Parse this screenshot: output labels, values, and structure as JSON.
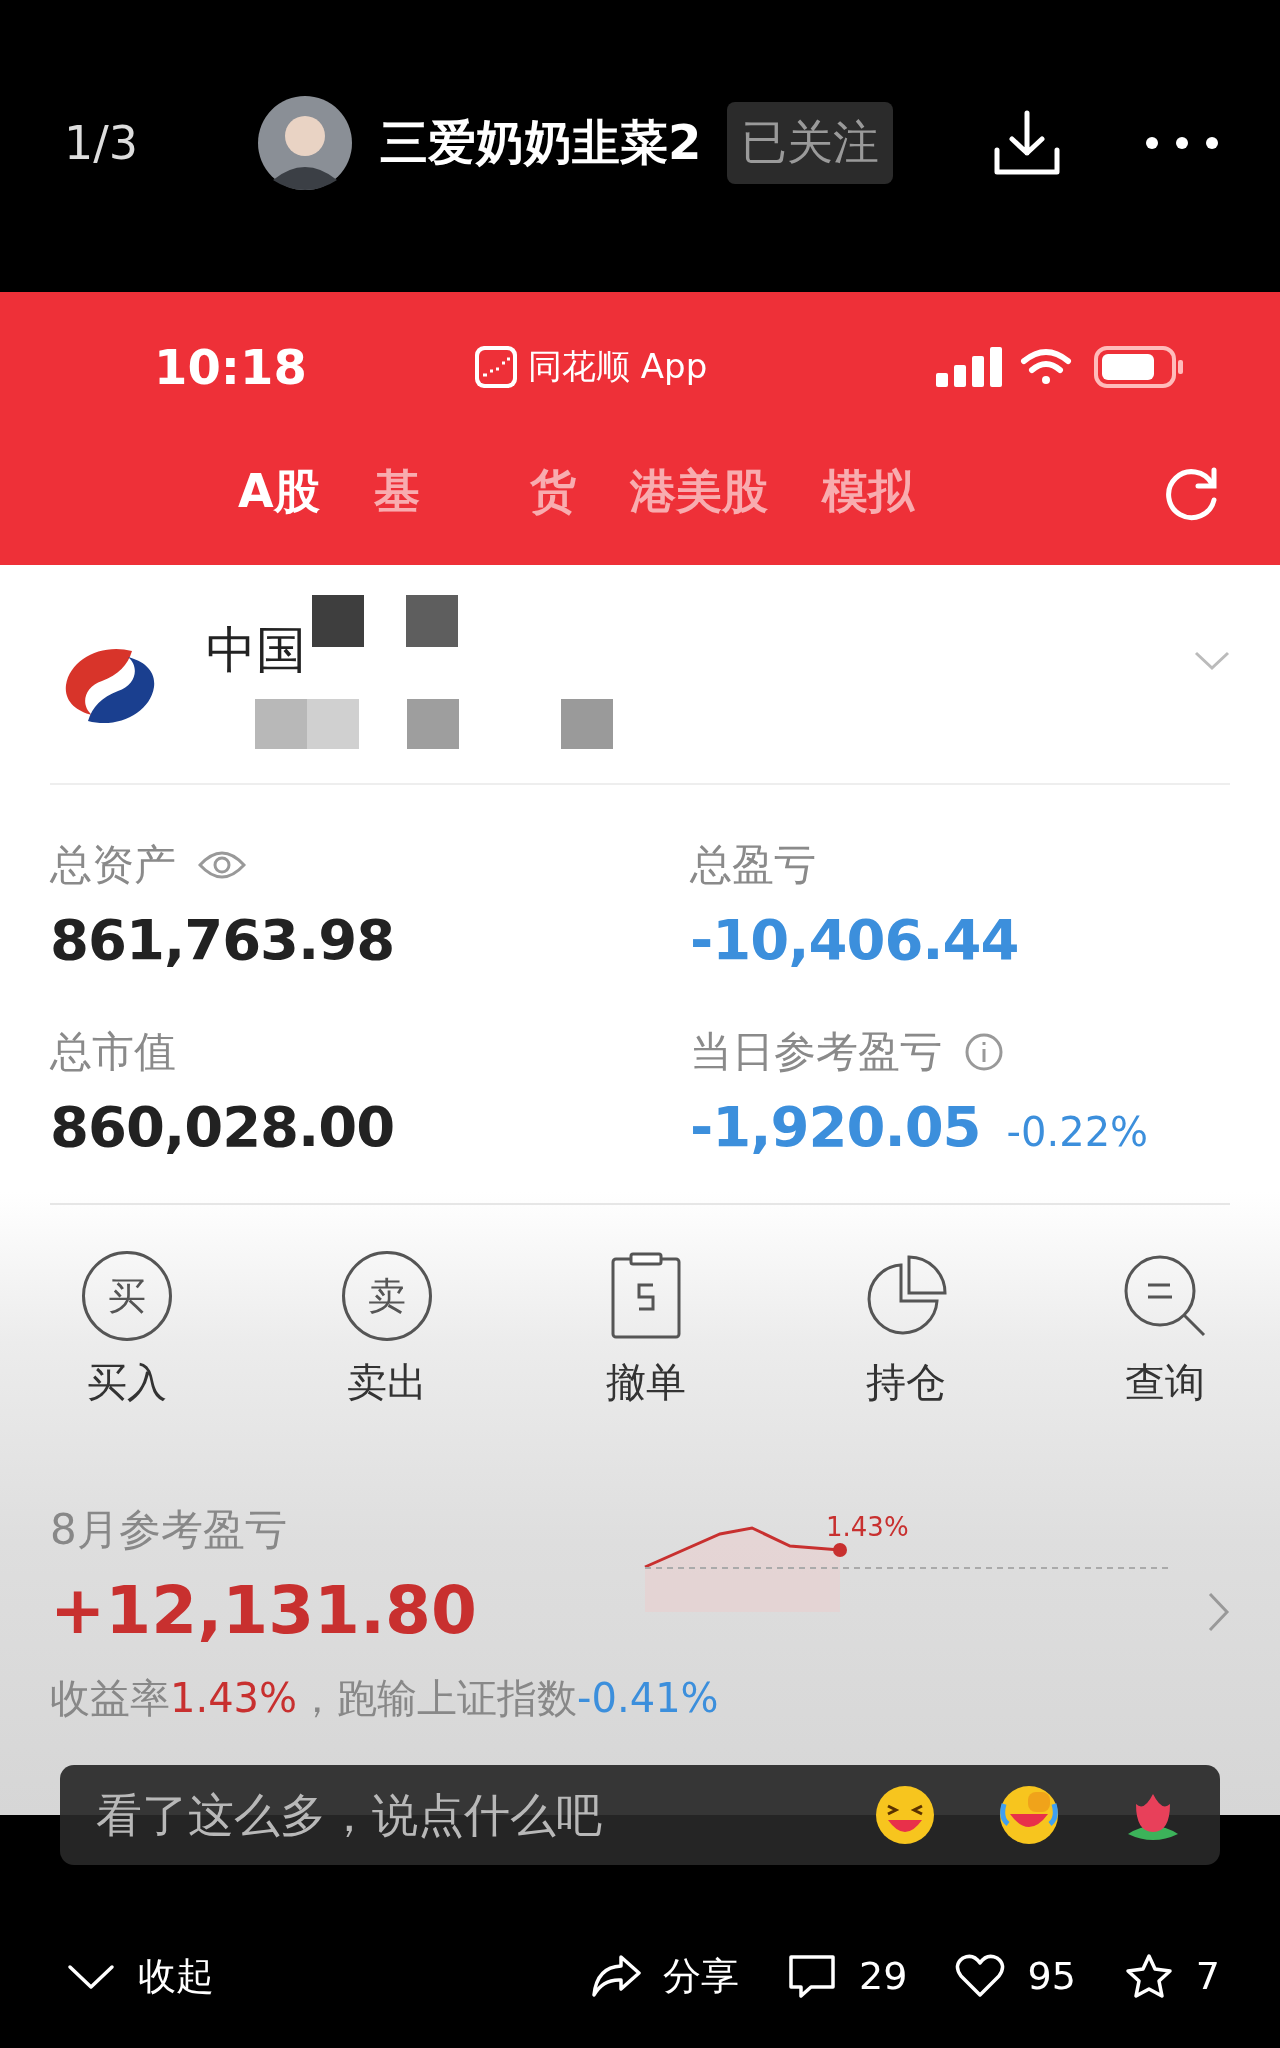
{
  "post_bar": {
    "page_counter": "1/3",
    "author": "三爱奶奶韭菜2",
    "follow_button": "已关注"
  },
  "app_status_bar": {
    "time": "10:18",
    "app_name": "同花顺 App"
  },
  "tabs": [
    {
      "label": "A股",
      "selected": true
    },
    {
      "label": "基",
      "selected": false
    },
    {
      "label": "货",
      "selected": false
    },
    {
      "label": "港美股",
      "selected": false
    },
    {
      "label": "模拟",
      "selected": false
    }
  ],
  "account": {
    "name": "中国"
  },
  "stats": [
    {
      "label": "总资产",
      "value": "861,763.98",
      "kind": "plain"
    },
    {
      "label": "总盈亏",
      "value": "-10,406.44",
      "kind": "loss"
    },
    {
      "label": "总市值",
      "value": "860,028.00",
      "kind": "plain"
    },
    {
      "label": "当日参考盈亏",
      "value": "-1,920.05",
      "change": "-0.22%",
      "kind": "loss"
    }
  ],
  "actions": [
    {
      "label": "买入",
      "kind": "glyph",
      "glyph": "买"
    },
    {
      "label": "卖出",
      "kind": "glyph",
      "glyph": "卖"
    },
    {
      "label": "撤单",
      "kind": "clipboard"
    },
    {
      "label": "持仓",
      "kind": "pie"
    },
    {
      "label": "查询",
      "kind": "search"
    }
  ],
  "monthly": {
    "label": "8月参考盈亏",
    "value": "+12,131.80",
    "chart_label": "1.43%",
    "rate_label": "收益率",
    "rate": "1.43%",
    "vs_label": "，跑输上证指数",
    "vs": "-0.41%"
  },
  "comment_bar": {
    "placeholder": "看了这么多，说点什么吧"
  },
  "bottom_bar": {
    "collapse": "收起",
    "share": "分享",
    "comments": "29",
    "likes": "95",
    "favorites": "7"
  }
}
